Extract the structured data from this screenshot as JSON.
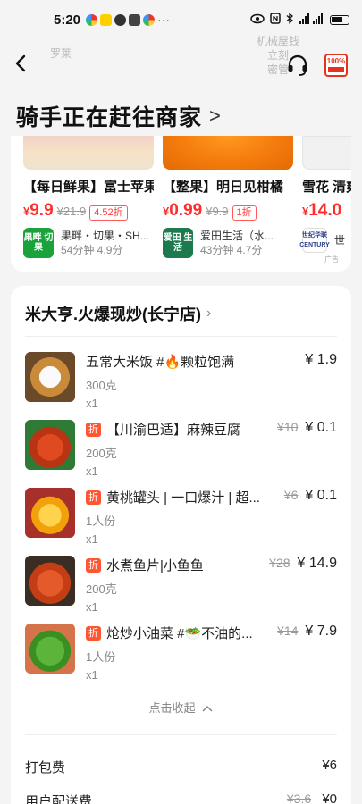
{
  "status_bar": {
    "time": "5:20",
    "more": "···",
    "signal": "4G"
  },
  "header": {
    "faded_left": "罗莱",
    "faded_right_1": "机械屋钱",
    "faded_right_2": "立刻",
    "faded_right_3": "密管",
    "badge_text": "100%"
  },
  "order_status": {
    "title": "骑手正在赶往商家",
    "chevron": ">"
  },
  "recommendations": [
    {
      "name": "【每日鲜果】富士苹果",
      "price_symbol": "¥",
      "price": "9.9",
      "original_price": "¥21.9",
      "discount": "4.52折",
      "shop_logo_text": "果畔 切果",
      "shop_name": "果畔・切果・SH...",
      "shop_meta": "54分钟  4.9分",
      "image": "apple"
    },
    {
      "name": "【整果】明日见柑橘",
      "price_symbol": "¥",
      "price": "0.99",
      "original_price": "¥9.9",
      "discount": "1折",
      "shop_logo_text": "爱田 生活",
      "shop_name": "爱田生活（水...",
      "shop_meta": "43分钟  4.7分",
      "image": "orange"
    },
    {
      "name": "雪花 清爽",
      "price_symbol": "¥",
      "price": "14.0",
      "original_price": "",
      "discount": "",
      "shop_logo_text": "世纪华联 CENTURY",
      "shop_name": "世",
      "shop_meta": "",
      "image": "flower"
    }
  ],
  "ad_label": "广告",
  "order": {
    "store_name": "米大亨.火爆现炒(长宁店)",
    "items": [
      {
        "name": "五常大米饭 #🔥颗粒饱满",
        "spec": "300克",
        "qty": "x1",
        "price": "¥ 1.9",
        "old_price": "",
        "tag": "",
        "image": "rice"
      },
      {
        "name": "【川渝巴适】麻辣豆腐",
        "spec": "200克",
        "qty": "x1",
        "price": "¥ 0.1",
        "old_price": "¥10",
        "tag": "折",
        "image": "tofu"
      },
      {
        "name": "黄桃罐头 | 一口爆汁 | 超...",
        "spec": "1人份",
        "qty": "x1",
        "price": "¥ 0.1",
        "old_price": "¥6",
        "tag": "折",
        "image": "peach"
      },
      {
        "name": "水煮鱼片|小鱼鱼",
        "spec": "200克",
        "qty": "x1",
        "price": "¥ 14.9",
        "old_price": "¥28",
        "tag": "折",
        "image": "fish"
      },
      {
        "name": "炝炒小油菜 #🥗不油的...",
        "spec": "1人份",
        "qty": "x1",
        "price": "¥ 7.9",
        "old_price": "¥14",
        "tag": "折",
        "image": "veg"
      }
    ],
    "collapse_label": "点击收起",
    "packing_fee_label": "打包费",
    "packing_fee": "¥6",
    "delivery_fee_label": "用户配送费",
    "delivery_fee_old": "¥3.6",
    "delivery_fee": "¥0"
  }
}
